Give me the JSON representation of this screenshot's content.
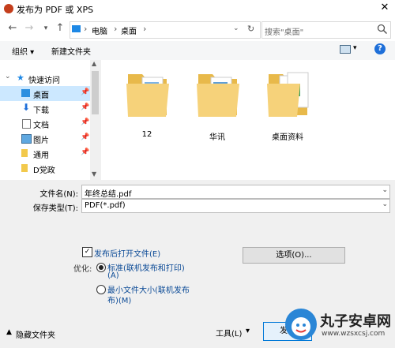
{
  "window": {
    "title": "发布为 PDF 或 XPS"
  },
  "address": {
    "crumbs": [
      "电脑",
      "桌面"
    ],
    "search_placeholder": "搜索\"桌面\""
  },
  "toolbar": {
    "organize": "组织 ▾",
    "new_folder": "新建文件夹",
    "view_arrow": "▾",
    "help": "?"
  },
  "nav": {
    "quick_access": "快速访问",
    "items": [
      {
        "label": "桌面",
        "icon": "desktop-icon",
        "pin": "📌"
      },
      {
        "label": "下载",
        "icon": "download-icon",
        "pin": "📌"
      },
      {
        "label": "文档",
        "icon": "document-icon",
        "pin": "📌"
      },
      {
        "label": "图片",
        "icon": "picture-icon",
        "pin": "📌"
      },
      {
        "label": "通用",
        "icon": "folder-icon",
        "pin": "📌"
      },
      {
        "label": "D党政",
        "icon": "folder-icon",
        "pin": ""
      }
    ]
  },
  "files": [
    {
      "name": "12",
      "icon": "folder-icon"
    },
    {
      "name": "华讯",
      "icon": "folder-icon"
    },
    {
      "name": "桌面资料",
      "icon": "folder-icon"
    }
  ],
  "form": {
    "filename_label": "文件名(N):",
    "filename_value": "年终总结.pdf",
    "type_label": "保存类型(T):",
    "type_value": "PDF(*.pdf)",
    "open_after": "发布后打开文件(E)",
    "optimize_label": "优化:",
    "opt_standard_l1": "标准(联机发布和打印)",
    "opt_standard_l2": "(A)",
    "opt_min_l1": "最小文件大小(联机发布",
    "opt_min_l2": "布)(M)",
    "options_button": "选项(O)...",
    "hide_folders": "隐藏文件夹",
    "tools": "工具(L)",
    "tools_arrow": "▾",
    "publish": "发布"
  },
  "watermark": {
    "text": "丸子安卓网",
    "url": "www.wzsxcsj.com"
  }
}
